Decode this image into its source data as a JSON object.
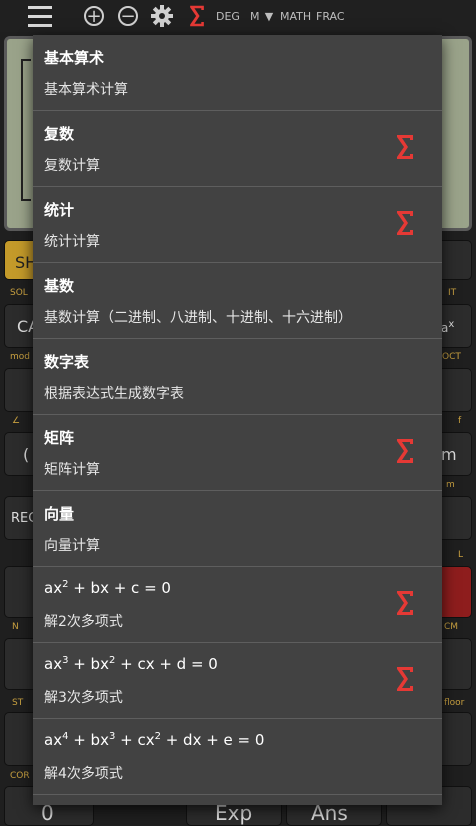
{
  "toolbar": {
    "menu_icon": "hamburger-icon",
    "add_icon": "plus-circle-icon",
    "remove_icon": "minus-circle-icon",
    "settings_icon": "gear-icon",
    "sigma_icon": "sigma-icon",
    "angle_mode": "DEG",
    "memory": "M",
    "math_mode": "MATH",
    "frac_mode": "FRAC",
    "accent": "#e53935"
  },
  "backdrop_keys": {
    "shift": "SH",
    "sol": "SOL",
    "ca": "CA",
    "mod": "mod",
    "oct": "OCT",
    "rec": "REC",
    "st": "ST",
    "cor": "COR",
    "floor": "floor",
    "cm": "CM",
    "exp": "Exp",
    "ans": "Ans",
    "zero": "0",
    "ri": "IT",
    "open_paren": "(",
    "m_key": "m",
    "l_label": "L",
    "angle": "∠",
    "f_label": "f",
    "n_label": "N",
    "ax_sup": "a",
    "ax_x": "x",
    "right_m": "m"
  },
  "menu": {
    "items": [
      {
        "title": "基本算术",
        "subtitle": "基本算术计算",
        "sigma": false
      },
      {
        "title": "复数",
        "subtitle": "复数计算",
        "sigma": true
      },
      {
        "title": "统计",
        "subtitle": "统计计算",
        "sigma": true
      },
      {
        "title": "基数",
        "subtitle": "基数计算（二进制、八进制、十进制、十六进制）",
        "sigma": false
      },
      {
        "title": "数字表",
        "subtitle": "根据表达式生成数字表",
        "sigma": false
      },
      {
        "title": "矩阵",
        "subtitle": "矩阵计算",
        "sigma": true
      },
      {
        "title": "向量",
        "subtitle": "向量计算",
        "sigma": false
      },
      {
        "title_parts": [
          "ax",
          "2",
          " + bx + c = 0"
        ],
        "subtitle": "解2次多项式",
        "sigma": true
      },
      {
        "title_parts": [
          "ax",
          "3",
          " + bx",
          "2",
          " + cx + d = 0"
        ],
        "subtitle": "解3次多项式",
        "sigma": true
      },
      {
        "title_parts": [
          "ax",
          "4",
          " + bx",
          "3",
          " + cx",
          "2",
          " + dx + e = 0"
        ],
        "subtitle": "解4次多项式",
        "sigma": false
      }
    ]
  }
}
